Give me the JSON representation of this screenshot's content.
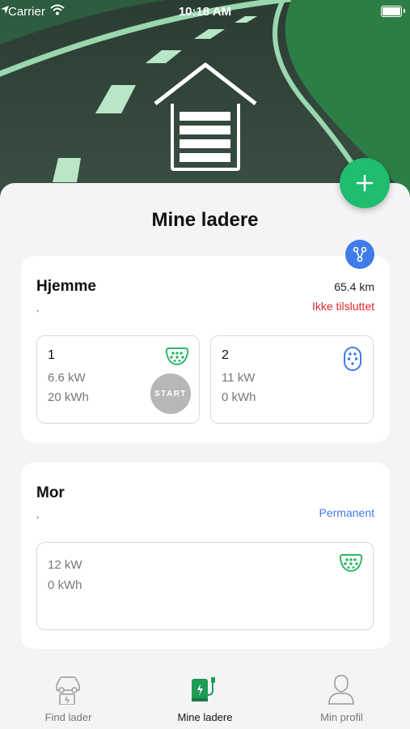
{
  "status_bar": {
    "carrier": "Carrier",
    "time": "10:18 AM"
  },
  "header": {
    "title": "Mine ladere"
  },
  "chargers": [
    {
      "name": "Hjemme",
      "subtitle": ",",
      "distance": "65.4 km",
      "status": "Ikke tilsluttet",
      "status_color": "#e0262b",
      "connectors": [
        {
          "number": "1",
          "power": "6.6 kW",
          "energy": "20 kWh",
          "icon": "type2-plug-icon",
          "icon_color": "#2fb86a",
          "start_label": "START"
        },
        {
          "number": "2",
          "power": "11 kW",
          "energy": "0 kWh",
          "icon": "type1-plug-icon",
          "icon_color": "#3f7bea"
        }
      ]
    },
    {
      "name": "Mor",
      "subtitle": ",",
      "status": "Permanent",
      "status_color": "#3f7bea",
      "connectors": [
        {
          "power": "12 kW",
          "energy": "0 kWh",
          "icon": "type2-plug-icon",
          "icon_color": "#2fb86a"
        }
      ]
    }
  ],
  "tabbar": {
    "items": [
      {
        "label": "Find lader",
        "icon": "find-charger-icon"
      },
      {
        "label": "Mine ladere",
        "icon": "my-chargers-icon",
        "active": true
      },
      {
        "label": "Min profil",
        "icon": "profile-icon"
      }
    ]
  },
  "colors": {
    "accent_green": "#1fbd6f",
    "accent_blue": "#3f7bea",
    "error_red": "#e0262b"
  }
}
